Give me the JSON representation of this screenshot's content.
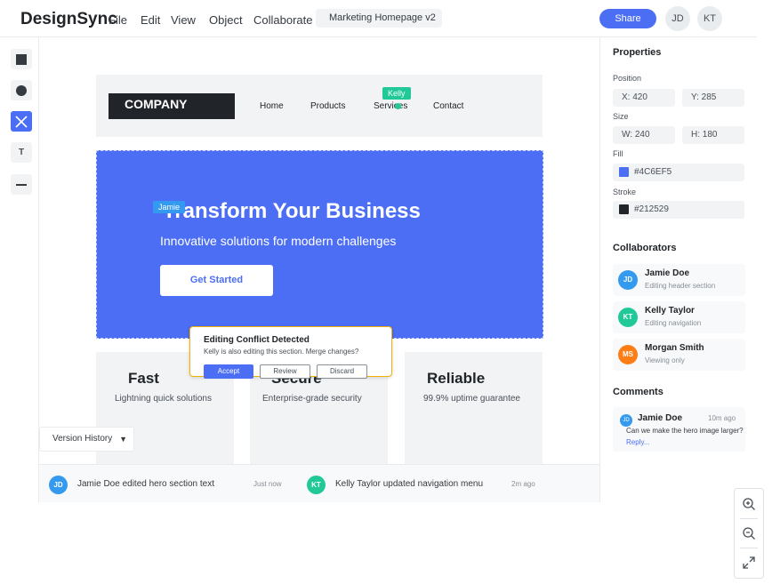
{
  "app": {
    "brand": "DesignSync",
    "menu": [
      "File",
      "Edit",
      "View",
      "Object",
      "Collaborate"
    ],
    "document_name": "Marketing Homepage v2",
    "share_label": "Share",
    "avatars": [
      "JD",
      "KT"
    ]
  },
  "tools": [
    "rectangle-icon",
    "circle-icon",
    "frame-icon",
    "text-icon",
    "line-icon"
  ],
  "tool_text": "T",
  "canvas": {
    "header": {
      "logo": "COMPANY",
      "nav": [
        "Home",
        "Products",
        "Services",
        "Contact"
      ],
      "cursor_label": "Kelly"
    },
    "hero": {
      "title": "Transform Your Business",
      "subtitle": "Innovative solutions for modern challenges",
      "button": "Get Started",
      "cursor_label": "Jamie"
    },
    "features": [
      {
        "title": "Fast",
        "desc": "Lightning quick solutions"
      },
      {
        "title": "Secure",
        "desc": "Enterprise-grade security"
      },
      {
        "title": "Reliable",
        "desc": "99.9% uptime guarantee"
      }
    ]
  },
  "conflict": {
    "title": "Editing Conflict Detected",
    "message": "Kelly is also editing this section. Merge changes?",
    "accept": "Accept",
    "review": "Review",
    "discard": "Discard"
  },
  "version_history": {
    "label": "Version History",
    "caret": "▼"
  },
  "activity": [
    {
      "initials": "JD",
      "text": "Jamie Doe edited hero section text",
      "time": "Just now",
      "color": "#339af0"
    },
    {
      "initials": "KT",
      "text": "Kelly Taylor updated navigation menu",
      "time": "2m ago",
      "color": "#20c997"
    }
  ],
  "properties": {
    "heading": "Properties",
    "position_label": "Position",
    "x": "X: 420",
    "y": "Y: 285",
    "size_label": "Size",
    "w": "W: 240",
    "h": "H: 180",
    "fill_label": "Fill",
    "fill": "#4C6EF5",
    "stroke_label": "Stroke",
    "stroke": "#212529"
  },
  "collaborators": {
    "heading": "Collaborators",
    "list": [
      {
        "initials": "JD",
        "name": "Jamie Doe",
        "status": "Editing header section",
        "color": "#339af0"
      },
      {
        "initials": "KT",
        "name": "Kelly Taylor",
        "status": "Editing navigation",
        "color": "#20c997"
      },
      {
        "initials": "MS",
        "name": "Morgan Smith",
        "status": "Viewing only",
        "color": "#fd7e14"
      }
    ]
  },
  "comments": {
    "heading": "Comments",
    "items": [
      {
        "initials": "JD",
        "author": "Jamie Doe",
        "time": "10m ago",
        "text": "Can we make the hero image larger?",
        "reply": "Reply..."
      }
    ]
  },
  "colors": {
    "accent": "#4c6ef5",
    "kelly": "#20c997",
    "jamie": "#339af0",
    "conflict_border": "#f6b100"
  }
}
